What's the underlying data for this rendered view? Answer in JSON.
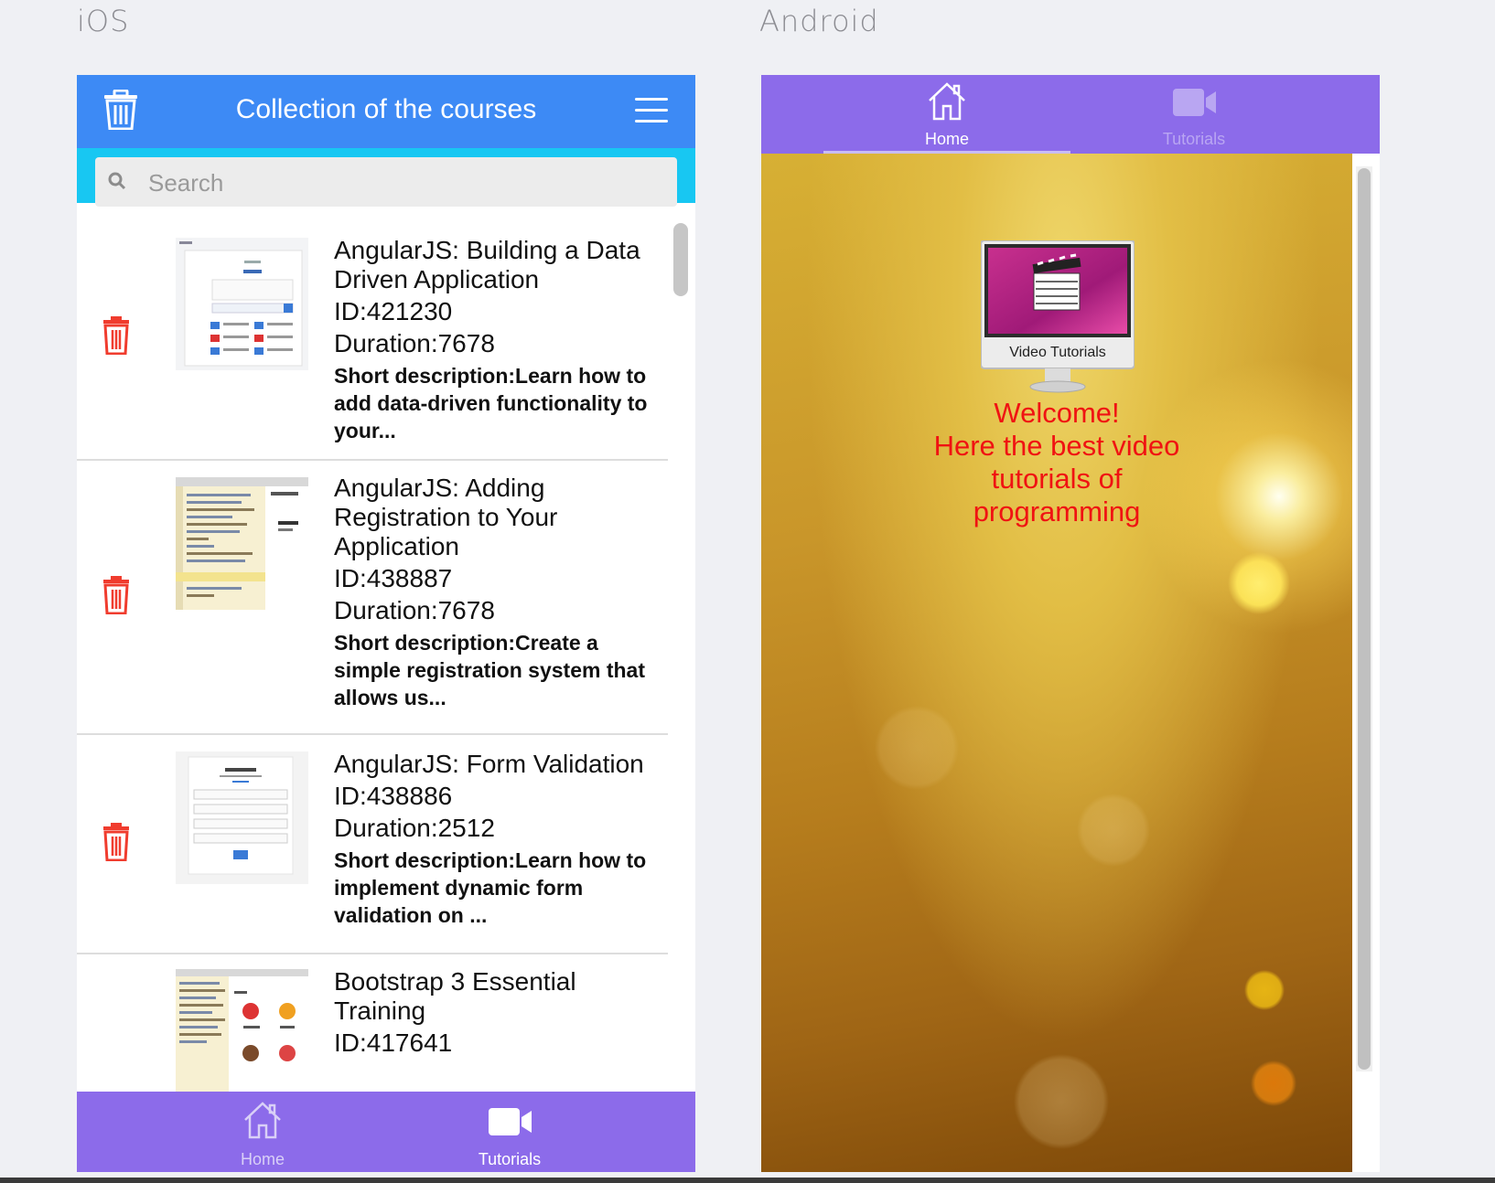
{
  "labels": {
    "ios": "iOS",
    "android": "Android"
  },
  "ios": {
    "header": {
      "title": "Collection of the courses"
    },
    "search": {
      "placeholder": "Search"
    },
    "courses": [
      {
        "title": "AngularJS: Building a Data Driven Application",
        "id": "ID:421230",
        "duration": "Duration:7678",
        "description": "Short description:Learn how to add data-driven functionality to your..."
      },
      {
        "title": "AngularJS: Adding Registration to Your Application",
        "id": "ID:438887",
        "duration": "Duration:7678",
        "description": "Short description:Create a simple registration system that allows us..."
      },
      {
        "title": "AngularJS: Form Validation",
        "id": "ID:438886",
        "duration": "Duration:2512",
        "description": "Short description:Learn how to implement dynamic form validation on ..."
      },
      {
        "title": "Bootstrap 3 Essential Training",
        "id": "ID:417641",
        "duration": "",
        "description": ""
      }
    ],
    "tabs": [
      {
        "label": "Home",
        "icon": "home-icon"
      },
      {
        "label": "Tutorials",
        "icon": "video-camera-icon"
      }
    ]
  },
  "android": {
    "tabs": [
      {
        "label": "Home",
        "icon": "home-icon",
        "active": true
      },
      {
        "label": "Tutorials",
        "icon": "video-camera-icon",
        "active": false
      }
    ],
    "monitor_caption": "Video Tutorials",
    "welcome": [
      "Welcome!",
      "Here the best video",
      "tutorials of",
      "programming"
    ]
  },
  "colors": {
    "ios_header": "#3d8af5",
    "search_bar": "#18c7f2",
    "tab_bar": "#8c6bea",
    "delete_red": "#f03c2e",
    "welcome_text": "#f01212"
  }
}
